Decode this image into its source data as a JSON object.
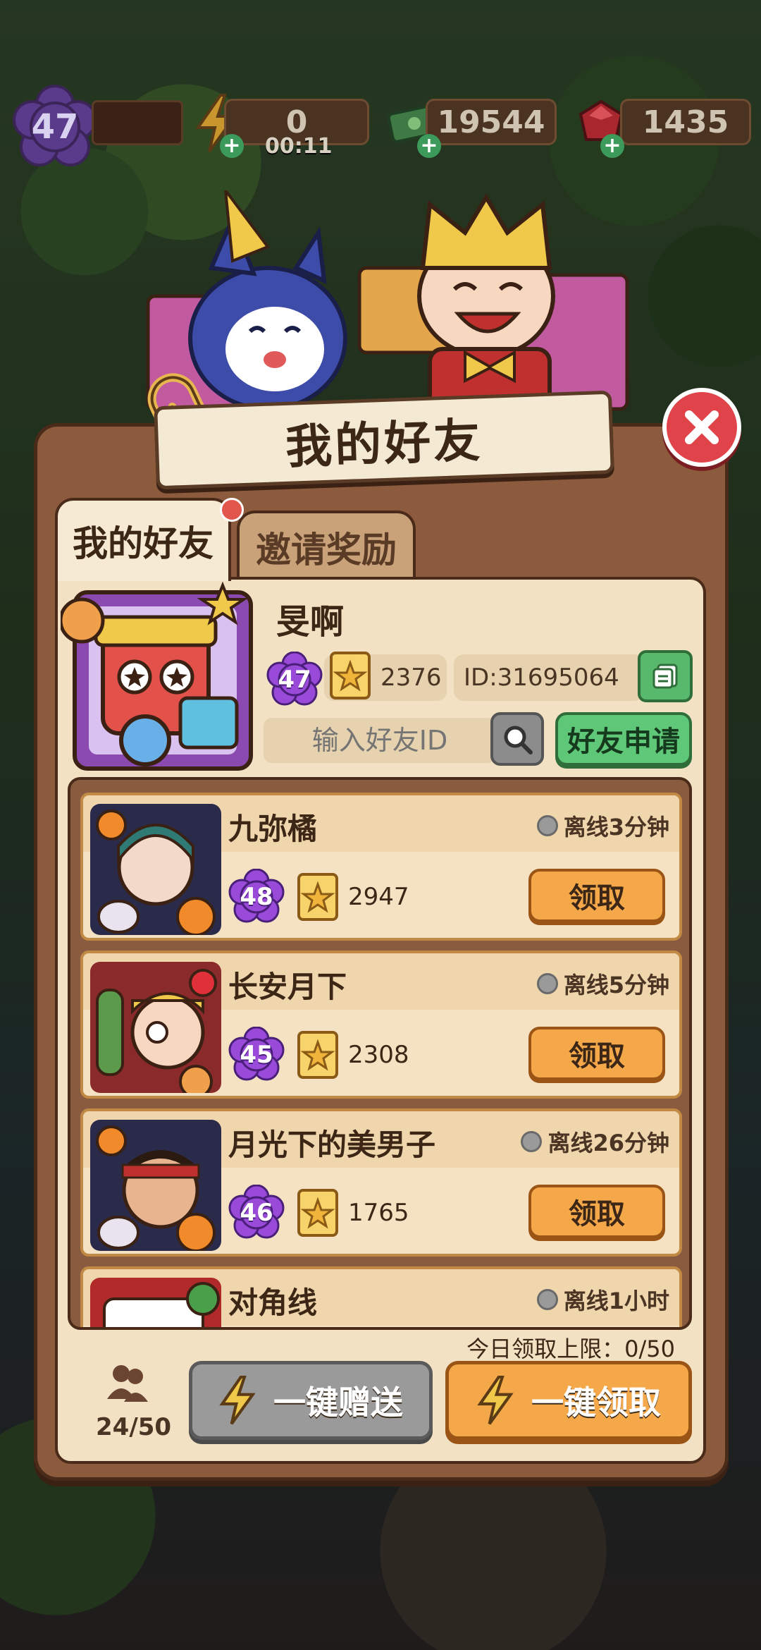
{
  "hud": {
    "player_level": "47",
    "energy": "0",
    "energy_timer": "00:11",
    "cash": "19544",
    "gems": "1435"
  },
  "dialog": {
    "title": "我的好友",
    "tabs": [
      {
        "label": "我的好友",
        "active": true
      },
      {
        "label": "邀请奖励",
        "active": false
      }
    ]
  },
  "profile": {
    "name": "旻啊",
    "level": "47",
    "cards": "2376",
    "id_text": "ID:31695064",
    "search_placeholder": "输入好友ID",
    "apply_label": "好友申请"
  },
  "friends": [
    {
      "name": "九弥橘",
      "status": "离线3分钟",
      "level": "48",
      "cards": "2947",
      "claim_label": "领取"
    },
    {
      "name": "长安月下",
      "status": "离线5分钟",
      "level": "45",
      "cards": "2308",
      "claim_label": "领取"
    },
    {
      "name": "月光下的美男子",
      "status": "离线26分钟",
      "level": "46",
      "cards": "1765",
      "claim_label": "领取"
    },
    {
      "name": "对角线",
      "status": "离线1小时"
    }
  ],
  "footer": {
    "daily_limit": "今日领取上限：0/50",
    "friend_count": "24/50",
    "gift_all_label": "一键赠送",
    "claim_all_label": "一键领取"
  },
  "colors": {
    "accent_orange": "#f5a84a",
    "accent_green": "#5fc878",
    "panel_cream": "#f2e2c3",
    "level_purple": "#9a4ad8"
  }
}
